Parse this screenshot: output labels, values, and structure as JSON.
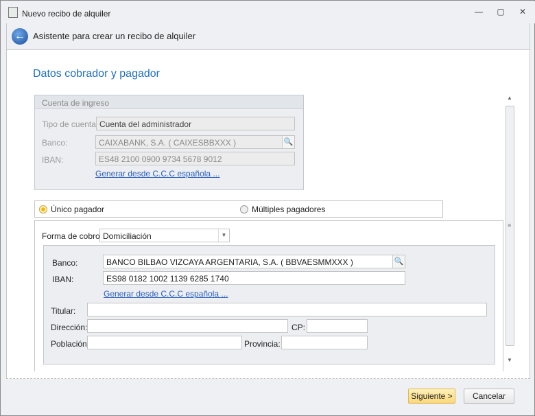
{
  "window": {
    "title": "Nuevo recibo de alquiler",
    "minimize": "—",
    "maximize": "▢",
    "close": "✕"
  },
  "header": {
    "title": "Asistente para crear un recibo de alquiler"
  },
  "section_title": "Datos cobrador y pagador",
  "cuenta_ingreso": {
    "title": "Cuenta de ingreso",
    "tipo_label": "Tipo de cuenta:",
    "tipo_value": "Cuenta del administrador",
    "banco_label": "Banco:",
    "banco_value": "CAIXABANK, S.A. ( CAIXESBBXXX )",
    "iban_label": "IBAN:",
    "iban_value": "ES48 2100 0900 9734 5678 9012",
    "link": "Generar desde C.C.C española ..."
  },
  "pagador": {
    "unico": "Único pagador",
    "multiples": "Múltiples pagadores",
    "selected": "unico"
  },
  "forma_cobro": {
    "label": "Forma de cobro:",
    "value": "Domiciliación"
  },
  "pagador_datos": {
    "banco_label": "Banco:",
    "banco_value": "BANCO BILBAO VIZCAYA ARGENTARIA, S.A. ( BBVAESMMXXX )",
    "iban_label": "IBAN:",
    "iban_value": "ES98 0182 1002 1139 6285 1740",
    "link": "Generar desde C.C.C española ...",
    "titular_label": "Titular:",
    "titular_value": "",
    "direccion_label": "Dirección:",
    "direccion_value": "",
    "cp_label": "CP:",
    "cp_value": "",
    "poblacion_label": "Población:",
    "poblacion_value": "",
    "provincia_label": "Provincia:",
    "provincia_value": ""
  },
  "footer": {
    "next": "Siguiente >",
    "cancel": "Cancelar"
  }
}
